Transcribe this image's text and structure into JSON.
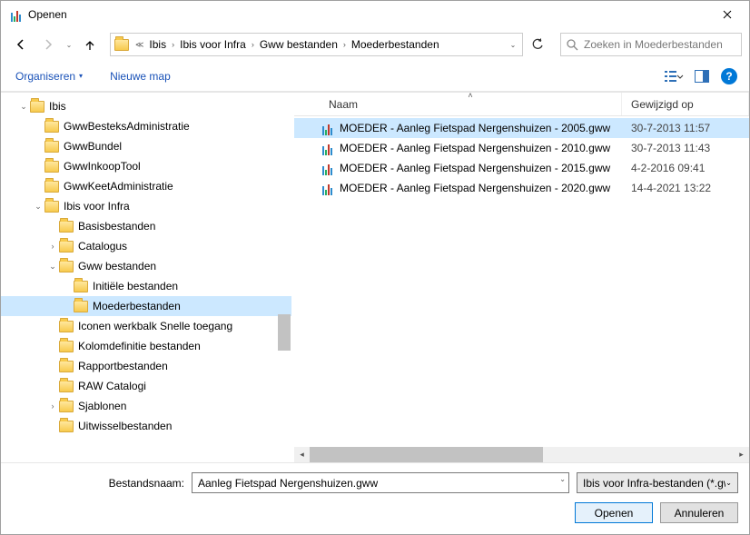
{
  "title": "Openen",
  "breadcrumbs": [
    "Ibis",
    "Ibis voor Infra",
    "Gww bestanden",
    "Moederbestanden"
  ],
  "search": {
    "placeholder": "Zoeken in Moederbestanden"
  },
  "toolbar": {
    "organize": "Organiseren",
    "newfolder": "Nieuwe map"
  },
  "columns": {
    "name": "Naam",
    "modified": "Gewijzigd op"
  },
  "tree": [
    {
      "label": "Ibis",
      "depth": 0,
      "expander": "v"
    },
    {
      "label": "GwwBesteksAdministratie",
      "depth": 1,
      "expander": ""
    },
    {
      "label": "GwwBundel",
      "depth": 1,
      "expander": ""
    },
    {
      "label": "GwwInkoopTool",
      "depth": 1,
      "expander": ""
    },
    {
      "label": "GwwKeetAdministratie",
      "depth": 1,
      "expander": ""
    },
    {
      "label": "Ibis voor Infra",
      "depth": 1,
      "expander": "v"
    },
    {
      "label": "Basisbestanden",
      "depth": 2,
      "expander": ""
    },
    {
      "label": "Catalogus",
      "depth": 2,
      "expander": ">"
    },
    {
      "label": "Gww bestanden",
      "depth": 2,
      "expander": "v"
    },
    {
      "label": "Initiële bestanden",
      "depth": 3,
      "expander": ""
    },
    {
      "label": "Moederbestanden",
      "depth": 3,
      "expander": "",
      "selected": true
    },
    {
      "label": "Iconen werkbalk Snelle toegang",
      "depth": 2,
      "expander": ""
    },
    {
      "label": "Kolomdefinitie bestanden",
      "depth": 2,
      "expander": ""
    },
    {
      "label": "Rapportbestanden",
      "depth": 2,
      "expander": ""
    },
    {
      "label": "RAW Catalogi",
      "depth": 2,
      "expander": ""
    },
    {
      "label": "Sjablonen",
      "depth": 2,
      "expander": ">"
    },
    {
      "label": "Uitwisselbestanden",
      "depth": 2,
      "expander": ""
    }
  ],
  "files": [
    {
      "name": "MOEDER - Aanleg Fietspad Nergenshuizen - 2005.gww",
      "modified": "30-7-2013 11:57",
      "selected": true
    },
    {
      "name": "MOEDER - Aanleg Fietspad Nergenshuizen - 2010.gww",
      "modified": "30-7-2013 11:43"
    },
    {
      "name": "MOEDER - Aanleg Fietspad Nergenshuizen - 2015.gww",
      "modified": "4-2-2016 09:41"
    },
    {
      "name": "MOEDER - Aanleg Fietspad Nergenshuizen - 2020.gww",
      "modified": "14-4-2021 13:22"
    }
  ],
  "bottom": {
    "filename_label": "Bestandsnaam:",
    "filename_value": "Aanleg Fietspad Nergenshuizen.gww",
    "filter": "Ibis voor Infra-bestanden (*.gw",
    "open": "Openen",
    "cancel": "Annuleren"
  }
}
